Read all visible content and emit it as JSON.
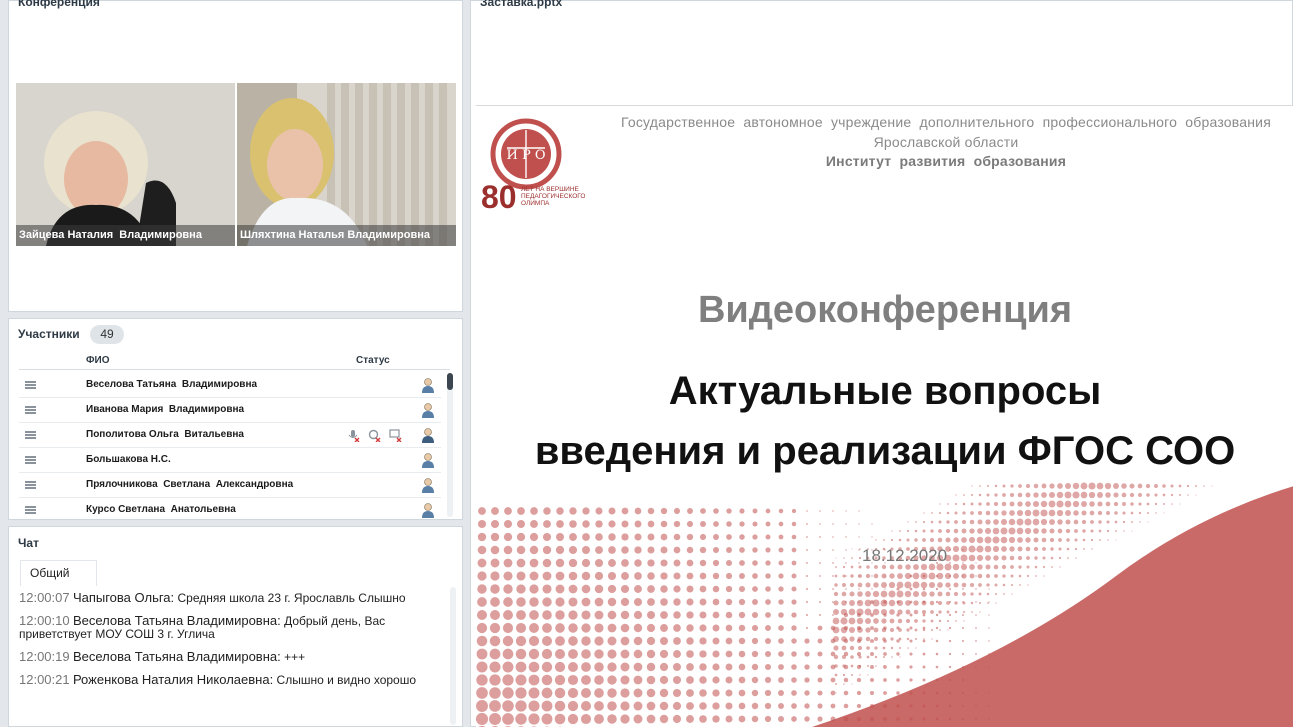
{
  "conference": {
    "title": "Конференция",
    "videos": [
      {
        "name": "Зайцева Наталия  Владимировна"
      },
      {
        "name": "Шляхтина Наталья Владимировна"
      }
    ]
  },
  "participants": {
    "title": "Участники",
    "count": "49",
    "col_name": "ФИО",
    "col_status": "Статус",
    "rows": [
      {
        "name": "Веселова Татьяна  Владимировна"
      },
      {
        "name": "Иванова Мария  Владимировна"
      },
      {
        "name": "Пополитова Ольга  Витальевна"
      },
      {
        "name": "Большакова Н.С."
      },
      {
        "name": "Прялочникова  Светлана  Александровна"
      },
      {
        "name": "Курсо Светлана  Анатольевна"
      }
    ]
  },
  "chat": {
    "title": "Чат",
    "tab": "Общий",
    "messages": [
      {
        "time": "12:00:07",
        "author": "Чапыгова Ольга:",
        "text": "Средняя школа  23 г. Ярославль Слышно"
      },
      {
        "time": "12:00:10",
        "author": "Веселова Татьяна  Владимировна:",
        "text": "Добрый день, Вас приветствует МОУ СОШ 3 г. Углича"
      },
      {
        "time": "12:00:19",
        "author": "Веселова Татьяна  Владимировна:",
        "text": "+++"
      },
      {
        "time": "12:00:21",
        "author": "Роженкова Наталия Николаевна:",
        "text": "Слышно  и видно хорошо"
      }
    ]
  },
  "presentation": {
    "title": "Заставка.pptx",
    "org_line1": "Государственное  автономное  учреждение  дополнительного  профессионального  образования",
    "org_line2": "Ярославской области",
    "org_line3": "Институт  развития  образования",
    "heading": "Видеоконференция",
    "subtitle1": "Актуальные вопросы",
    "subtitle2": "введения и реализации ФГОС СОО",
    "date": "18.12.2020",
    "logo": {
      "letters": "И Р О",
      "years": "80",
      "motto": "ЛЕТ НА ВЕРШИНЕ ПЕДАГОГИЧЕСКОГО ОЛИМПА"
    }
  },
  "colors": {
    "accent_red": "#c0504d",
    "panel_bg": "#ffffff",
    "app_bg": "#e3e7eb",
    "user_icon": "#5a7fa6"
  },
  "icons": [
    "grip-icon",
    "user-icon",
    "mic-muted-icon",
    "camera-muted-icon",
    "screen-muted-icon"
  ]
}
